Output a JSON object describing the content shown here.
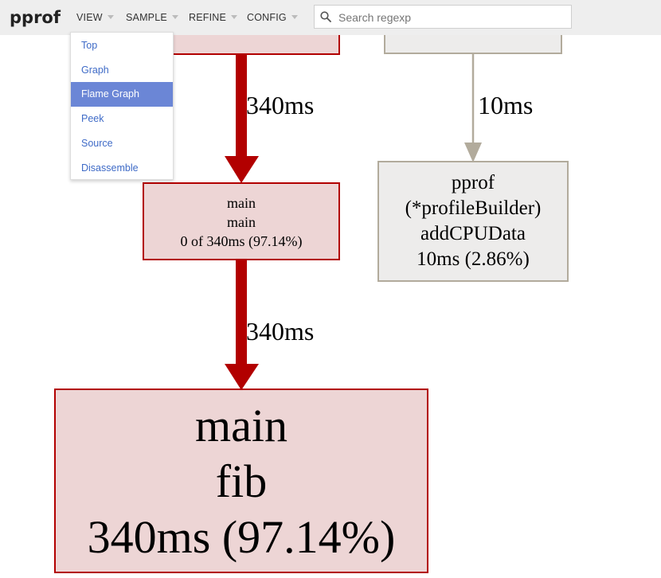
{
  "header": {
    "logo": "pprof",
    "menus": [
      "VIEW",
      "SAMPLE",
      "REFINE",
      "CONFIG"
    ],
    "search_placeholder": "Search regexp"
  },
  "view_menu": {
    "items": [
      "Top",
      "Graph",
      "Flame Graph",
      "Peek",
      "Source",
      "Disassemble"
    ],
    "active": "Flame Graph"
  },
  "graph": {
    "node_main_main": [
      "main",
      "main",
      "0 of 340ms (97.14%)"
    ],
    "node_add_cpu": [
      "pprof",
      "(*profileBuilder)",
      "addCPUData",
      "10ms (2.86%)"
    ],
    "node_main_fib": [
      "main",
      "fib",
      "340ms (97.14%)"
    ],
    "edge_top_main": "340ms",
    "edge_main_fib": "340ms",
    "edge_top_pprof": "10ms",
    "colors": {
      "hot_edge": "#b20000",
      "hot_fill": "#edd5d5",
      "cool_edge": "#b2ab9c",
      "cool_fill": "#edeceb"
    }
  }
}
